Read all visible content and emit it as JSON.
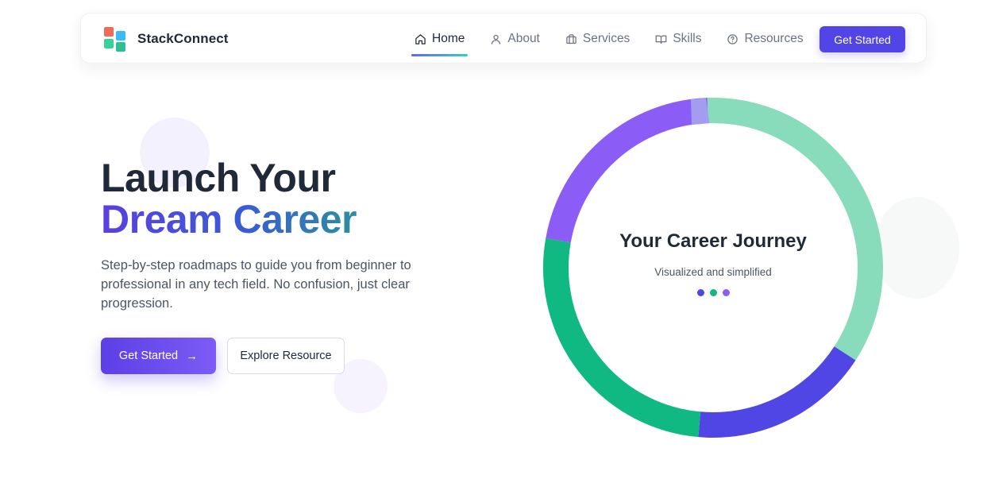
{
  "brand": {
    "name": "StackConnect"
  },
  "nav": {
    "items": [
      {
        "label": "Home",
        "icon": "home-icon",
        "active": true
      },
      {
        "label": "About",
        "icon": "user-icon",
        "active": false
      },
      {
        "label": "Services",
        "icon": "briefcase-icon",
        "active": false
      },
      {
        "label": "Skills",
        "icon": "book-icon",
        "active": false
      },
      {
        "label": "Resources",
        "icon": "help-circle-icon",
        "active": false
      }
    ],
    "cta_label": "Get Started"
  },
  "hero": {
    "title_line1": "Launch Your",
    "title_line2": "Dream Career",
    "description": "Step-by-step roadmaps to guide you from beginner to professional in any tech field. No confusion, just clear progression.",
    "primary_button": "Get Started",
    "primary_icon": "arrow-right-icon",
    "secondary_button": "Explore Resource"
  },
  "journey": {
    "title": "Your Career Journey",
    "subtitle": "Visualized and simplified",
    "dot_colors": [
      "#4f46e5",
      "#10b981",
      "#8b5cf6"
    ],
    "ring_colors": [
      "#88dcbb",
      "#4f46e5",
      "#10b981",
      "#8b5cf6",
      "#a49cf0"
    ]
  },
  "colors": {
    "accent": "#5145e5",
    "text": "#1f2937",
    "muted": "#6b7280"
  }
}
